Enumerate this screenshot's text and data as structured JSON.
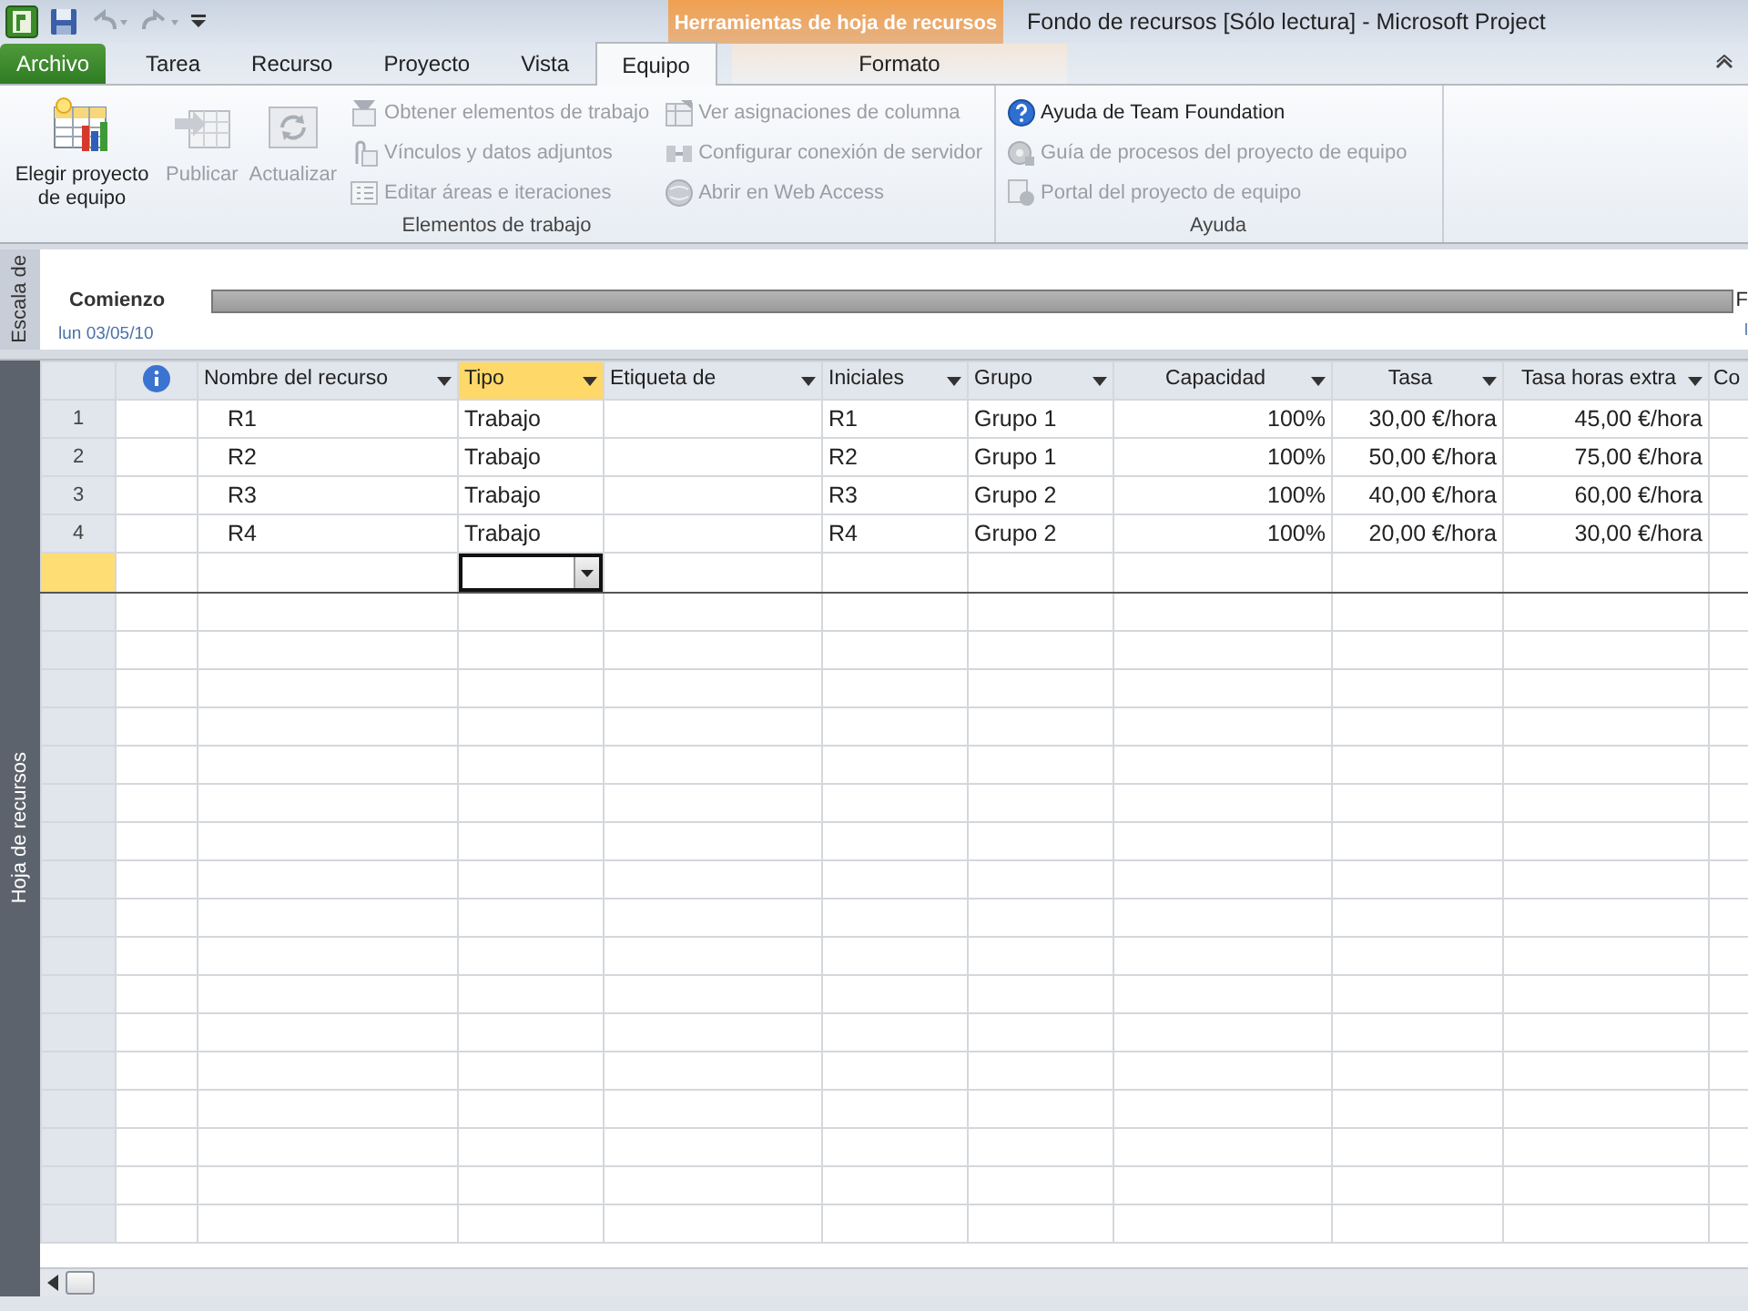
{
  "window": {
    "title": "Fondo de recursos [Sólo lectura]  -  Microsoft Project",
    "context_header": "Herramientas de hoja de recursos"
  },
  "tabs": [
    {
      "label": "Archivo",
      "kind": "file",
      "selected": false
    },
    {
      "label": "Tarea",
      "kind": "normal",
      "selected": false
    },
    {
      "label": "Recurso",
      "kind": "normal",
      "selected": false
    },
    {
      "label": "Proyecto",
      "kind": "normal",
      "selected": false
    },
    {
      "label": "Vista",
      "kind": "normal",
      "selected": false
    },
    {
      "label": "Equipo",
      "kind": "normal",
      "selected": true
    },
    {
      "label": "Formato",
      "kind": "context",
      "selected": false
    }
  ],
  "ribbon_groups": [
    {
      "label": "Elementos de trabajo",
      "large_buttons": [
        {
          "label": "Elegir proyecto de equipo",
          "disabled": false
        },
        {
          "label": "Publicar",
          "disabled": true
        },
        {
          "label": "Actualizar",
          "disabled": true
        }
      ],
      "columns": [
        [
          {
            "label": "Obtener elementos de trabajo",
            "disabled": true
          },
          {
            "label": "Vínculos y datos adjuntos",
            "disabled": true
          },
          {
            "label": "Editar áreas e iteraciones",
            "disabled": true
          }
        ],
        [
          {
            "label": "Ver asignaciones de columna",
            "disabled": true
          },
          {
            "label": "Configurar conexión de servidor",
            "disabled": true
          },
          {
            "label": "Abrir en Web Access",
            "disabled": true
          }
        ]
      ]
    },
    {
      "label": "Ayuda",
      "columns": [
        [
          {
            "label": "Ayuda de Team Foundation",
            "disabled": false
          },
          {
            "label": "Guía de procesos del proyecto de equipo",
            "disabled": true
          },
          {
            "label": "Portal del proyecto de equipo",
            "disabled": true
          }
        ]
      ]
    }
  ],
  "timeline": {
    "side_label": "Escala de",
    "start_label": "Comienzo",
    "start_date": "lun 03/05/10",
    "end_label": "F",
    "end_date": "l"
  },
  "view_bar": {
    "label": "Hoja de recursos"
  },
  "table": {
    "columns": [
      {
        "kind": "info",
        "selected": false
      },
      {
        "label": "Nombre del recurso",
        "kind": "text",
        "selected": false
      },
      {
        "label": "Tipo",
        "kind": "text",
        "selected": true
      },
      {
        "label": "Etiqueta de",
        "kind": "text",
        "selected": false
      },
      {
        "label": "Iniciales",
        "kind": "text",
        "selected": false
      },
      {
        "label": "Grupo",
        "kind": "text",
        "selected": false
      },
      {
        "label": "Capacidad",
        "kind": "number",
        "selected": false
      },
      {
        "label": "Tasa",
        "kind": "number",
        "selected": false
      },
      {
        "label": "Tasa horas extra",
        "kind": "number",
        "selected": false
      },
      {
        "label": "Co",
        "kind": "cut",
        "selected": false
      }
    ],
    "rows": [
      {
        "number": "1",
        "cells": [
          null,
          "R1",
          "Trabajo",
          null,
          "R1",
          "Grupo 1",
          "100%",
          "30,00 €/hora",
          "45,00 €/hora",
          null
        ]
      },
      {
        "number": "2",
        "cells": [
          null,
          "R2",
          "Trabajo",
          null,
          "R2",
          "Grupo 1",
          "100%",
          "50,00 €/hora",
          "75,00 €/hora",
          null
        ]
      },
      {
        "number": "3",
        "cells": [
          null,
          "R3",
          "Trabajo",
          null,
          "R3",
          "Grupo 2",
          "100%",
          "40,00 €/hora",
          "60,00 €/hora",
          null
        ]
      },
      {
        "number": "4",
        "cells": [
          null,
          "R4",
          "Trabajo",
          null,
          "R4",
          "Grupo 2",
          "100%",
          "20,00 €/hora",
          "30,00 €/hora",
          null
        ]
      }
    ],
    "new_row": {
      "selected": true
    }
  }
}
